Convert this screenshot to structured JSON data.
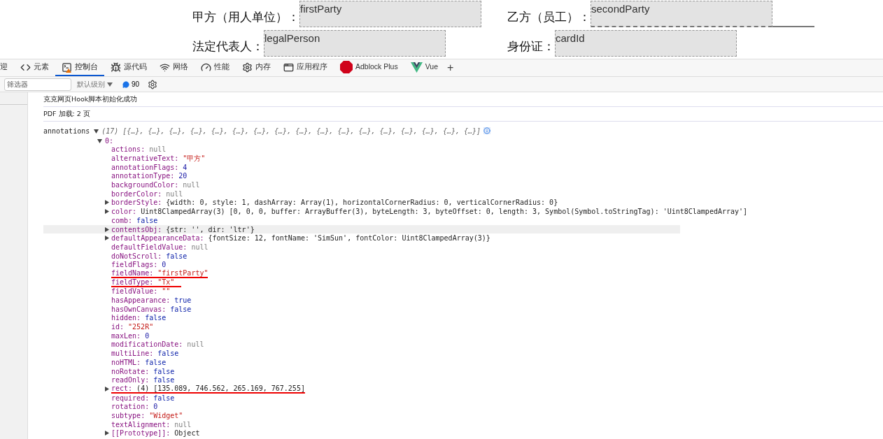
{
  "pdf_form": {
    "rows": [
      {
        "fields": [
          {
            "label": "甲方（用人单位）：",
            "value": "firstParty",
            "underlined": false
          },
          {
            "label": "乙方（员工）：",
            "value": "secondParty",
            "underlined": true
          }
        ]
      },
      {
        "fields": [
          {
            "label": "法定代表人：",
            "value": "legalPerson",
            "underlined": false
          },
          {
            "label": "身份证：",
            "value": "cardId",
            "underlined": false
          }
        ]
      }
    ]
  },
  "devtools": {
    "tabs": [
      {
        "label": "迎",
        "kind": "none",
        "selected": false
      },
      {
        "label": "元素",
        "kind": "code",
        "selected": false
      },
      {
        "label": "控制台",
        "kind": "console",
        "selected": true
      },
      {
        "label": "源代码",
        "kind": "bug",
        "selected": false
      },
      {
        "label": "网络",
        "kind": "wifi",
        "selected": false
      },
      {
        "label": "性能",
        "kind": "gauge",
        "selected": false
      },
      {
        "label": "内存",
        "kind": "gear",
        "selected": false
      },
      {
        "label": "应用程序",
        "kind": "window",
        "selected": false
      },
      {
        "label": "Adblock Plus",
        "kind": "abp",
        "selected": false
      },
      {
        "label": "Vue",
        "kind": "vue",
        "selected": false
      }
    ],
    "add_tab": "+",
    "toolbar": {
      "filter_placeholder": "筛选器",
      "level": "默认级别",
      "message_count": "90"
    },
    "messages": [
      "克克网页Hook脚本初始化成功",
      "PDF 加载: 2 页"
    ],
    "annotations": {
      "label": "annotations",
      "summary": "(17) [{…}, {…}, {…}, {…}, {…}, {…}, {…}, {…}, {…}, {…}, {…}, {…}, {…}, {…}, {…}, {…}, {…}]",
      "item": "0:",
      "properties": [
        {
          "key": "actions:",
          "value": "null",
          "kind": "null",
          "expandable": false,
          "underlined": false,
          "highlighted": false
        },
        {
          "key": "alternativeText:",
          "value": "\"甲方\"",
          "kind": "string",
          "expandable": false,
          "underlined": false,
          "highlighted": false
        },
        {
          "key": "annotationFlags:",
          "value": "4",
          "kind": "number",
          "expandable": false,
          "underlined": false,
          "highlighted": false
        },
        {
          "key": "annotationType:",
          "value": "20",
          "kind": "number",
          "expandable": false,
          "underlined": false,
          "highlighted": false
        },
        {
          "key": "backgroundColor:",
          "value": "null",
          "kind": "null",
          "expandable": false,
          "underlined": false,
          "highlighted": false
        },
        {
          "key": "borderColor:",
          "value": "null",
          "kind": "null",
          "expandable": false,
          "underlined": false,
          "highlighted": false
        },
        {
          "key": "borderStyle:",
          "value": "{width: 0, style: 1, dashArray: Array(1), horizontalCornerRadius: 0, verticalCornerRadius: 0}",
          "kind": "object",
          "expandable": true,
          "underlined": false,
          "highlighted": false
        },
        {
          "key": "color:",
          "value": "Uint8ClampedArray(3) [0, 0, 0, buffer: ArrayBuffer(3), byteLength: 3, byteOffset: 0, length: 3, Symbol(Symbol.toStringTag): 'Uint8ClampedArray']",
          "kind": "object",
          "expandable": true,
          "underlined": false,
          "highlighted": false
        },
        {
          "key": "comb:",
          "value": "false",
          "kind": "boolean",
          "expandable": false,
          "underlined": false,
          "highlighted": false
        },
        {
          "key": "contentsObj:",
          "value": "{str: '', dir: 'ltr'}",
          "kind": "object",
          "expandable": true,
          "underlined": false,
          "highlighted": true
        },
        {
          "key": "defaultAppearanceData:",
          "value": "{fontSize: 12, fontName: 'SimSun', fontColor: Uint8ClampedArray(3)}",
          "kind": "object",
          "expandable": true,
          "underlined": false,
          "highlighted": false
        },
        {
          "key": "defaultFieldValue:",
          "value": "null",
          "kind": "null",
          "expandable": false,
          "underlined": false,
          "highlighted": false
        },
        {
          "key": "doNotScroll:",
          "value": "false",
          "kind": "boolean",
          "expandable": false,
          "underlined": false,
          "highlighted": false
        },
        {
          "key": "fieldFlags:",
          "value": "0",
          "kind": "number",
          "expandable": false,
          "underlined": false,
          "highlighted": false
        },
        {
          "key": "fieldName:",
          "value": "\"firstParty\"",
          "kind": "string",
          "expandable": false,
          "underlined": true,
          "highlighted": false
        },
        {
          "key": "fieldType:",
          "value": "\"Tx\"",
          "kind": "string",
          "expandable": false,
          "underlined": true,
          "highlighted": false
        },
        {
          "key": "fieldValue:",
          "value": "\"\"",
          "kind": "string",
          "expandable": false,
          "underlined": false,
          "highlighted": false
        },
        {
          "key": "hasAppearance:",
          "value": "true",
          "kind": "boolean",
          "expandable": false,
          "underlined": false,
          "highlighted": false
        },
        {
          "key": "hasOwnCanvas:",
          "value": "false",
          "kind": "boolean",
          "expandable": false,
          "underlined": false,
          "highlighted": false
        },
        {
          "key": "hidden:",
          "value": "false",
          "kind": "boolean",
          "expandable": false,
          "underlined": false,
          "highlighted": false
        },
        {
          "key": "id:",
          "value": "\"252R\"",
          "kind": "string",
          "expandable": false,
          "underlined": false,
          "highlighted": false
        },
        {
          "key": "maxLen:",
          "value": "0",
          "kind": "number",
          "expandable": false,
          "underlined": false,
          "highlighted": false
        },
        {
          "key": "modificationDate:",
          "value": "null",
          "kind": "null",
          "expandable": false,
          "underlined": false,
          "highlighted": false
        },
        {
          "key": "multiLine:",
          "value": "false",
          "kind": "boolean",
          "expandable": false,
          "underlined": false,
          "highlighted": false
        },
        {
          "key": "noHTML:",
          "value": "false",
          "kind": "boolean",
          "expandable": false,
          "underlined": false,
          "highlighted": false
        },
        {
          "key": "noRotate:",
          "value": "false",
          "kind": "boolean",
          "expandable": false,
          "underlined": false,
          "highlighted": false
        },
        {
          "key": "readOnly:",
          "value": "false",
          "kind": "boolean",
          "expandable": false,
          "underlined": false,
          "highlighted": false
        },
        {
          "key": "rect:",
          "value": "(4) [135.089, 746.562, 265.169, 767.255]",
          "kind": "object",
          "expandable": true,
          "underlined": true,
          "highlighted": false
        },
        {
          "key": "required:",
          "value": "false",
          "kind": "boolean",
          "expandable": false,
          "underlined": false,
          "highlighted": false
        },
        {
          "key": "rotation:",
          "value": "0",
          "kind": "number",
          "expandable": false,
          "underlined": false,
          "highlighted": false
        },
        {
          "key": "subtype:",
          "value": "\"Widget\"",
          "kind": "string",
          "expandable": false,
          "underlined": false,
          "highlighted": false
        },
        {
          "key": "textAlignment:",
          "value": "null",
          "kind": "null",
          "expandable": false,
          "underlined": false,
          "highlighted": false
        },
        {
          "key": "[[Prototype]]:",
          "value": "Object",
          "kind": "object",
          "expandable": true,
          "underlined": false,
          "highlighted": false
        }
      ]
    }
  }
}
